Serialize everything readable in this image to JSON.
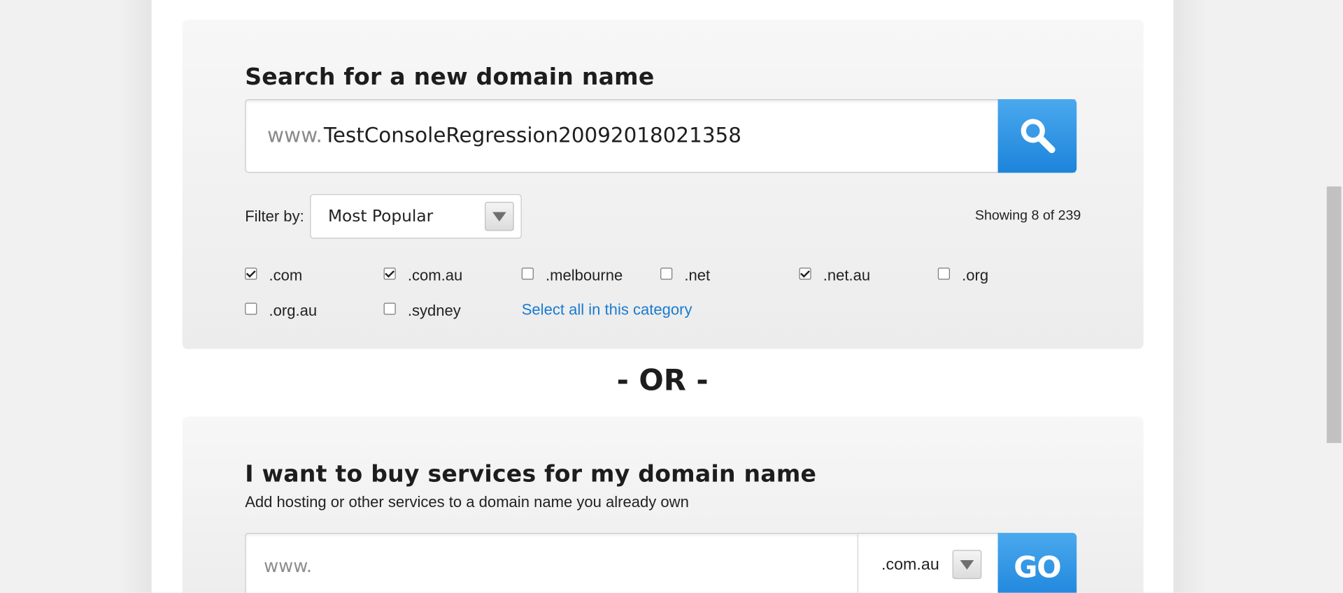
{
  "search_panel": {
    "title": "Search for a new domain name",
    "prefix": "www.",
    "value": "TestConsoleRegression20092018021358",
    "search_button_icon": "search-icon",
    "filter_label": "Filter by:",
    "filter_value": "Most Popular",
    "showing": "Showing 8 of 239",
    "tlds": [
      {
        "label": ".com",
        "checked": true
      },
      {
        "label": ".com.au",
        "checked": true
      },
      {
        "label": ".melbourne",
        "checked": false
      },
      {
        "label": ".net",
        "checked": false
      },
      {
        "label": ".net.au",
        "checked": true
      },
      {
        "label": ".org",
        "checked": false
      },
      {
        "label": ".org.au",
        "checked": false
      },
      {
        "label": ".sydney",
        "checked": false
      }
    ],
    "select_all": "Select all in this category"
  },
  "divider": "- OR -",
  "services_panel": {
    "title": "I want to buy services for my domain name",
    "subtitle": "Add hosting or other services to a domain name you already own",
    "prefix_placeholder": "www.",
    "tld_value": ".com.au",
    "go_label": "GO"
  },
  "colors": {
    "accent": "#2a90e0",
    "link": "#1a7bd0",
    "panel": "#f2f2f2"
  }
}
